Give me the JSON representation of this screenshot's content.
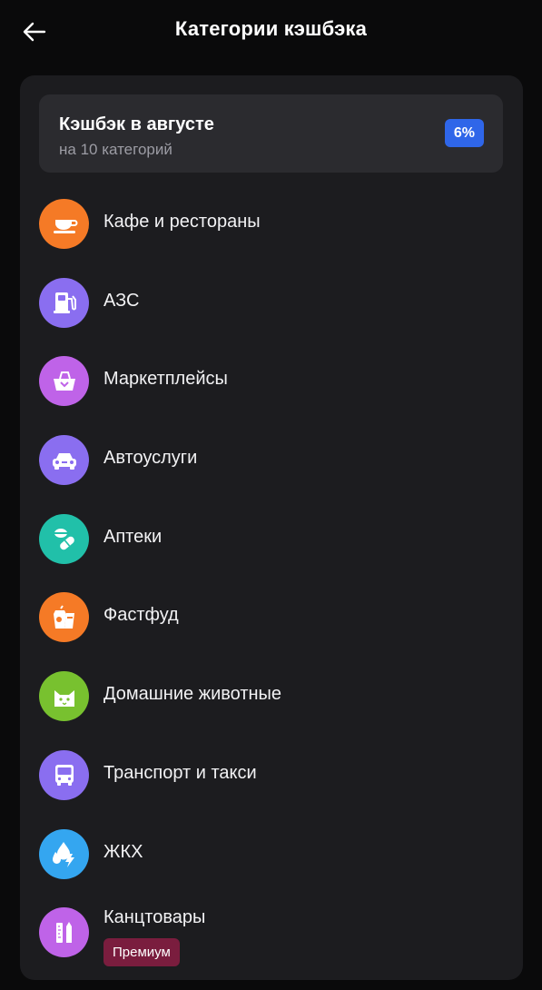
{
  "header": {
    "title": "Категории кэшбэка"
  },
  "summary": {
    "title": "Кэшбэк в августе",
    "subtitle": "на 10 категорий",
    "percent": "6%"
  },
  "categories": [
    {
      "label": "Кафе и рестораны",
      "icon": "cafe-icon",
      "color": "#f57a26"
    },
    {
      "label": "АЗС",
      "icon": "gas-station-icon",
      "color": "#8a6ef0"
    },
    {
      "label": "Маркетплейсы",
      "icon": "basket-icon",
      "color": "#bf63e8"
    },
    {
      "label": "Автоуслуги",
      "icon": "car-icon",
      "color": "#8a6ef0"
    },
    {
      "label": "Аптеки",
      "icon": "pills-icon",
      "color": "#21c0a9"
    },
    {
      "label": "Фастфуд",
      "icon": "fastfood-icon",
      "color": "#f57a26"
    },
    {
      "label": "Домашние животные",
      "icon": "cat-icon",
      "color": "#78c12f"
    },
    {
      "label": "Транспорт и такси",
      "icon": "bus-icon",
      "color": "#8a6ef0"
    },
    {
      "label": "ЖКХ",
      "icon": "utilities-icon",
      "color": "#34a6f0"
    },
    {
      "label": "Канцтовары",
      "icon": "stationery-icon",
      "color": "#bf63e8",
      "badge": "Премиум"
    }
  ]
}
